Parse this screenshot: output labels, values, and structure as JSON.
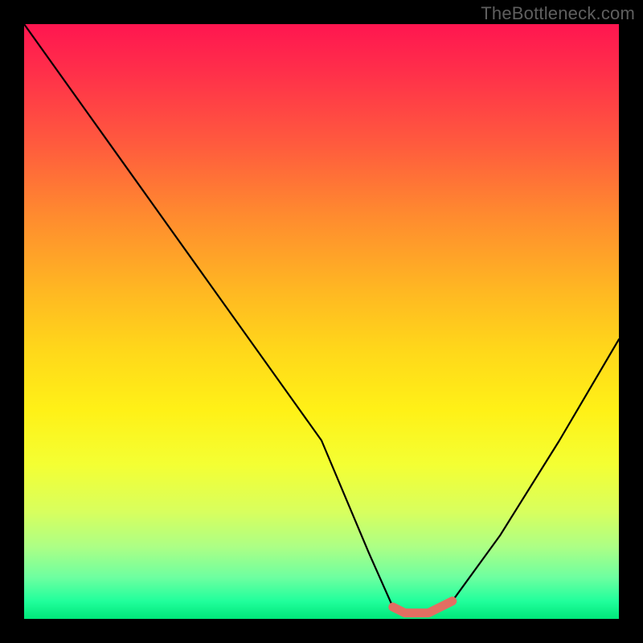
{
  "watermark": "TheBottleneck.com",
  "chart_data": {
    "type": "line",
    "title": "",
    "xlabel": "",
    "ylabel": "",
    "xlim": [
      0,
      100
    ],
    "ylim": [
      0,
      100
    ],
    "series": [
      {
        "name": "bottleneck-curve",
        "x": [
          0,
          10,
          20,
          30,
          40,
          50,
          58,
          62,
          64,
          68,
          72,
          80,
          90,
          100
        ],
        "values": [
          100,
          86,
          72,
          58,
          44,
          30,
          11,
          2,
          1,
          1,
          3,
          14,
          30,
          47
        ]
      }
    ],
    "highlight": {
      "name": "optimal-range",
      "x": [
        62,
        64,
        66,
        68,
        70,
        72
      ],
      "values": [
        2,
        1,
        1,
        1,
        2,
        3
      ]
    },
    "background": {
      "type": "vertical-gradient",
      "stops": [
        {
          "pos": 0,
          "color": "#ff1650"
        },
        {
          "pos": 50,
          "color": "#ffd81a"
        },
        {
          "pos": 100,
          "color": "#00e77a"
        }
      ]
    }
  }
}
